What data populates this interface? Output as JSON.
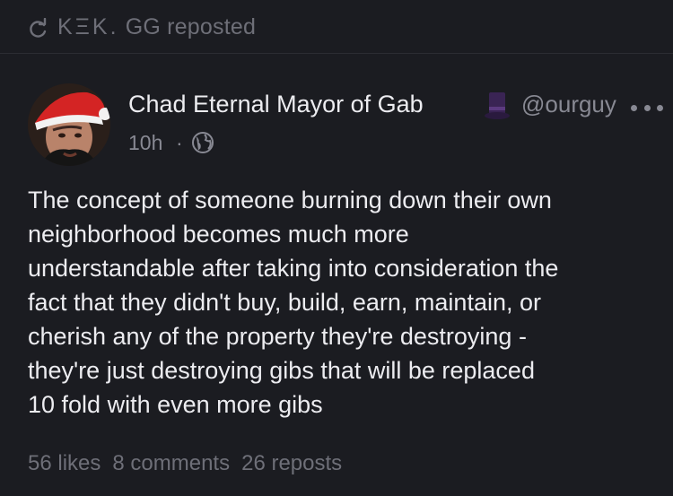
{
  "repost_bar": {
    "reposter_name": "KΞK.",
    "reposter_suffix": "GG",
    "action_text": "reposted"
  },
  "post": {
    "author": {
      "display_name": "Chad Eternal Mayor of Gab",
      "badge_icon": "top-hat-icon",
      "handle": "@ourguy"
    },
    "timestamp": "10h",
    "separator": "·",
    "visibility_icon": "globe-icon",
    "body_lines": [
      "The concept of someone burning down their own",
      "neighborhood becomes much more",
      "understandable after taking into consideration the",
      "fact that they didn't buy, build, earn, maintain, or",
      "cherish any of the property they're destroying -",
      "they're just destroying gibs that will be replaced",
      "10 fold with even more gibs"
    ],
    "stats": {
      "likes": "56 likes",
      "comments": "8 comments",
      "reposts": "26 reposts"
    }
  },
  "colors": {
    "background": "#1b1c21",
    "primary_text": "#ececf0",
    "muted_text": "#6e6f78",
    "secondary_text": "#888993"
  }
}
